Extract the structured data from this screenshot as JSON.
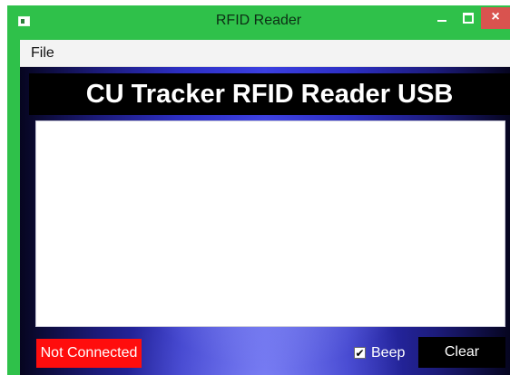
{
  "window": {
    "title": "RFID Reader",
    "close_glyph": "×",
    "titlebar_color": "#2fc14a",
    "icons": {
      "app": "app-window-icon",
      "minimize": "minimize-icon",
      "maximize": "maximize-icon",
      "close": "close-icon"
    }
  },
  "menu": {
    "items": [
      "File"
    ]
  },
  "banner": {
    "text": "CU Tracker RFID Reader USB"
  },
  "log": {
    "content": ""
  },
  "status": {
    "text": "Not Connected",
    "color": "#ff0d0d"
  },
  "options": {
    "beep_label": "Beep",
    "beep_checked": true,
    "check_glyph": "✔"
  },
  "actions": {
    "clear_label": "Clear"
  }
}
